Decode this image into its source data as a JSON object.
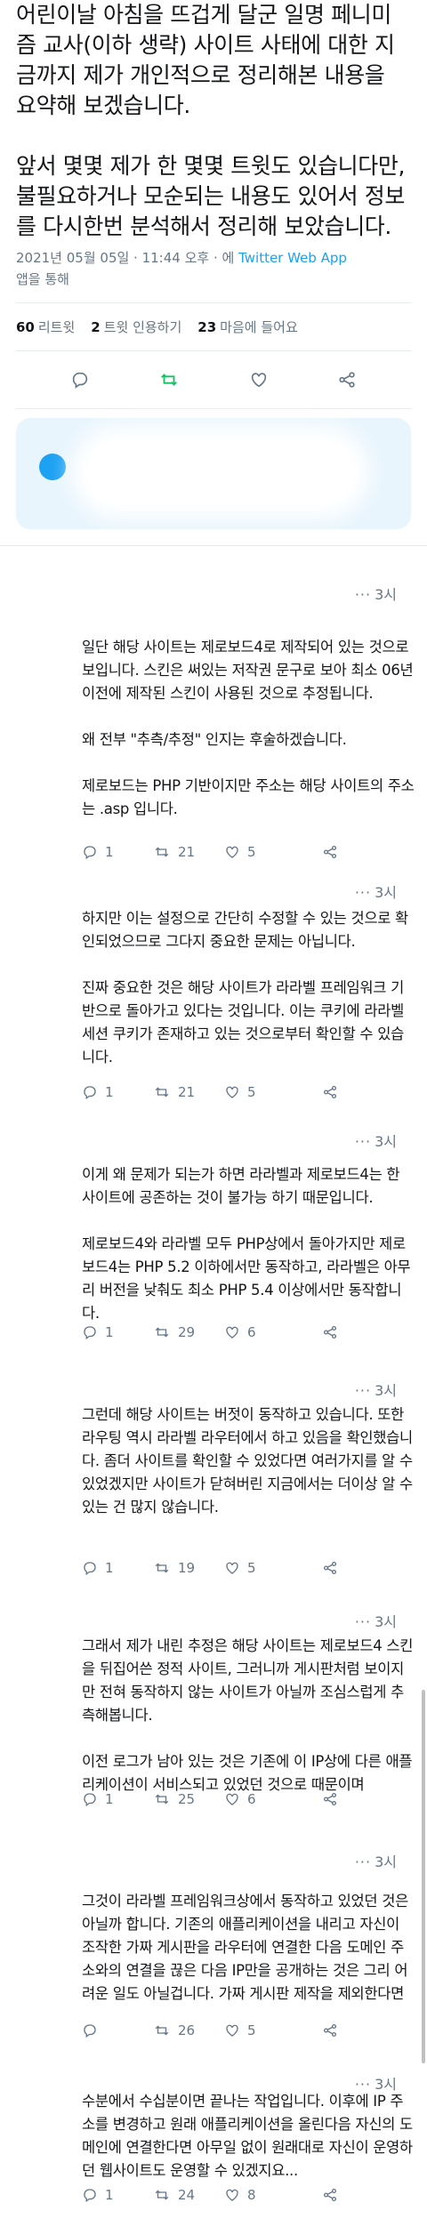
{
  "main_tweet": {
    "paragraphs": [
      "어린이날 아침을 뜨겁게 달군 일명 페니미즘 교사(이하 생략) 사이트 사태에 대한 지금까지 제가 개인적으로 정리해본 내용을 요약해 보겠습니다.",
      "앞서 몇몇 제가 한 몇몇 트윗도 있습니다만, 불필요하거나 모순되는 내용도 있어서 정보를 다시한번 분석해서 정리해 보았습니다."
    ],
    "timestamp": "2021년 05월 05일 · 11:44 오후 · 에",
    "app": "Twitter Web App",
    "app_suffix": "앱을 통해"
  },
  "stats": {
    "retweets_count": "60",
    "retweets_label": "리트윗",
    "quotes_count": "2",
    "quotes_label": "트윗 인용하기",
    "likes_count": "23",
    "likes_label": "마음에 들어요"
  },
  "icons": [
    "reply-icon",
    "retweet-icon",
    "like-icon",
    "share-icon",
    "more-icon"
  ],
  "colors": {
    "accent": "#1da1f2",
    "retweet_active": "#17bf63",
    "muted": "#657786"
  },
  "replies": [
    {
      "time": "3시",
      "paragraphs": [
        "일단 해당 사이트는 제로보드4로 제작되어 있는 것으로 보입니다. 스킨은 써있는 저작권 문구로 보아 최소 06년 이전에 제작된 스킨이 사용된 것으로 추정됩니다.",
        "왜 전부 \"추측/추정\" 인지는 후술하겠습니다.",
        "제로보드는 PHP 기반이지만 주소는 해당 사이트의 주소는 .asp 입니다."
      ],
      "reply_count": "1",
      "retweet_count": "21",
      "like_count": "5"
    },
    {
      "time": "3시",
      "paragraphs": [
        "하지만 이는 설정으로 간단히 수정할 수 있는 것으로 확인되었으므로 그다지 중요한 문제는 아닙니다.",
        "진짜 중요한 것은 해당 사이트가 라라벨 프레임워크 기반으로 돌아가고 있다는 것입니다. 이는 쿠키에 라라벨 세션 쿠키가 존재하고 있는 것으로부터 확인할 수 있습니다."
      ],
      "reply_count": "1",
      "retweet_count": "21",
      "like_count": "5"
    },
    {
      "time": "3시",
      "paragraphs": [
        "이게 왜 문제가 되는가 하면 라라벨과 제로보드4는 한 사이트에 공존하는 것이 불가능 하기 때문입니다.",
        "제로보드4와 라라벨 모두 PHP상에서 돌아가지만 제로보드4는 PHP 5.2 이하에서만 동작하고, 라라벨은 아무리 버전을 낮춰도 최소 PHP 5.4 이상에서만 동작합니다."
      ],
      "reply_count": "1",
      "retweet_count": "29",
      "like_count": "6"
    },
    {
      "time": "3시",
      "paragraphs": [
        "그런데 해당 사이트는 버젓이 동작하고 있습니다. 또한 라우팅 역시 라라벨 라우터에서 하고 있음을 확인했습니다. 좀더 사이트를 확인할 수 있었다면 여러가지를 알 수 있었겠지만 사이트가 닫혀버린 지금에서는 더이상 알 수 있는 건 많지 않습니다."
      ],
      "reply_count": "1",
      "retweet_count": "19",
      "like_count": "5"
    },
    {
      "time": "3시",
      "paragraphs": [
        "그래서 제가 내린 추정은 해당 사이트는 제로보드4 스킨을 뒤집어쓴 정적 사이트, 그러니까 게시판처럼 보이지만 전혀 동작하지 않는 사이트가 아닐까 조심스럽게 추측해봅니다.",
        "이전 로그가 남아 있는 것은 기존에 이 IP상에 다른 애플리케이션이 서비스되고 있었던 것으로 때문이며"
      ],
      "reply_count": "1",
      "retweet_count": "25",
      "like_count": "6"
    },
    {
      "time": "3시",
      "paragraphs": [
        "그것이 라라벨 프레임워크상에서 동작하고 있었던 것은 아닐까 합니다. 기존의 애플리케이션을 내리고 자신이 조작한 가짜 게시판을 라우터에 연결한 다음 도메인 주소와의 연결을 끊은 다음 IP만을 공개하는 것은 그리 어려운 일도 아닐겁니다. 가짜 게시판 제작을 제외한다면"
      ],
      "reply_count": "",
      "retweet_count": "26",
      "like_count": "5"
    },
    {
      "time": "3시",
      "paragraphs": [
        "수분에서 수십분이면 끝나는 작업입니다. 이후에 IP 주소를 변경하고 원래 애플리케이션을 올린다음 자신의 도메인에 연결한다면 아무일 없이 원래대로 자신이 운영하던 웹사이트도 운영할 수 있겠지요..."
      ],
      "reply_count": "1",
      "retweet_count": "24",
      "like_count": "8"
    }
  ]
}
